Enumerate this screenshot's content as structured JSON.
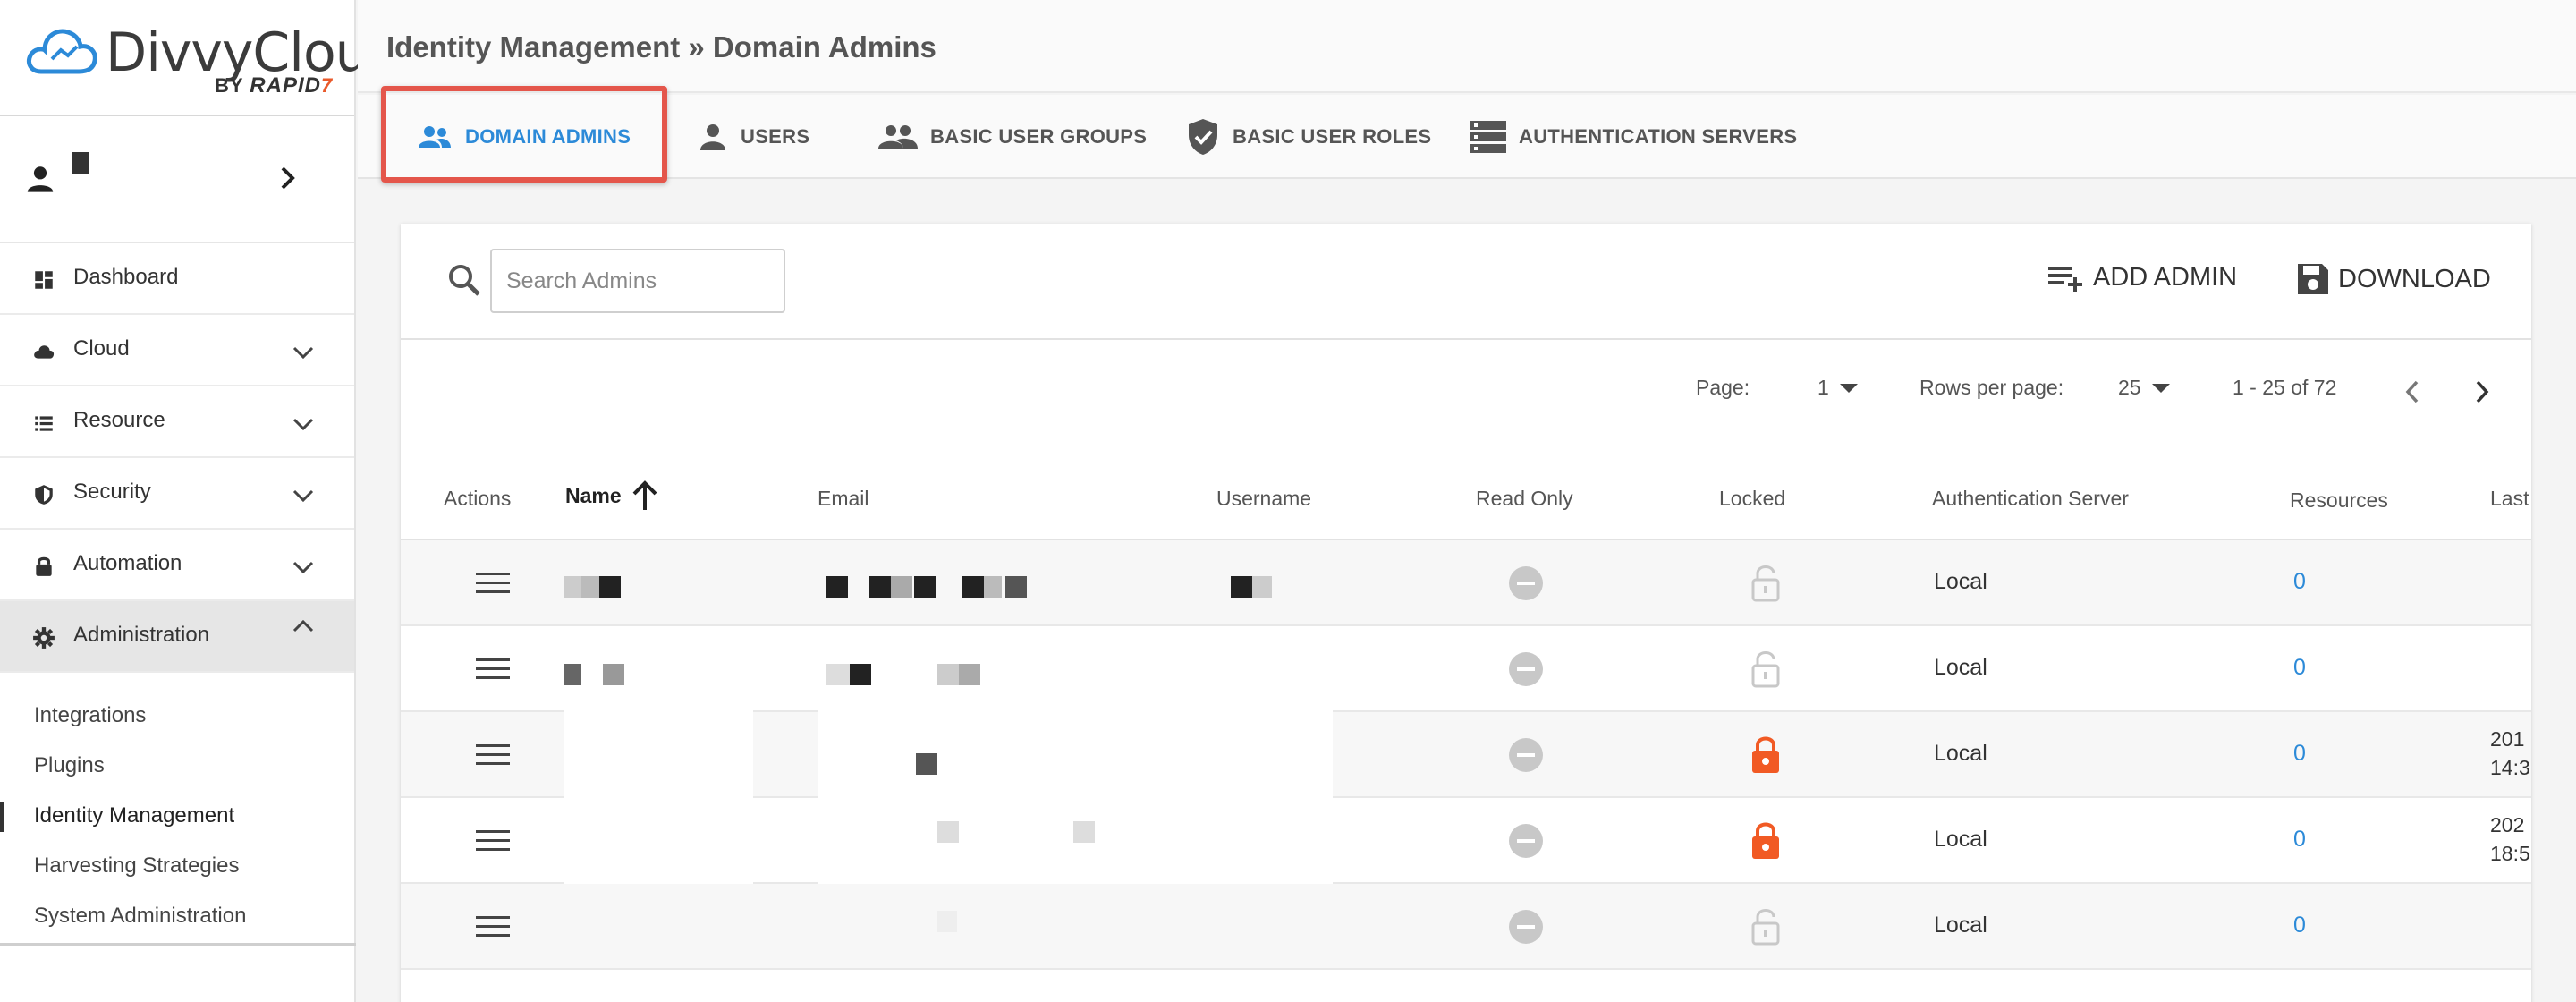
{
  "brand": {
    "name": "DivvyCloud",
    "by": "BY",
    "maker": "RAPID"
  },
  "sidebar": {
    "nav": [
      {
        "label": "Dashboard",
        "icon": "dashboard-icon"
      },
      {
        "label": "Cloud",
        "icon": "cloud-icon"
      },
      {
        "label": "Resource",
        "icon": "list-icon"
      },
      {
        "label": "Security",
        "icon": "shield-icon"
      },
      {
        "label": "Automation",
        "icon": "lock-icon"
      },
      {
        "label": "Administration",
        "icon": "gear-icon"
      }
    ],
    "sub_items": [
      "Integrations",
      "Plugins",
      "Identity Management",
      "Harvesting Strategies",
      "System Administration"
    ]
  },
  "header": {
    "title": "Identity Management » Domain Admins"
  },
  "tabs": [
    {
      "label": "DOMAIN ADMINS",
      "icon": "users-icon"
    },
    {
      "label": "USERS",
      "icon": "user-icon"
    },
    {
      "label": "BASIC USER GROUPS",
      "icon": "group-icon"
    },
    {
      "label": "BASIC USER ROLES",
      "icon": "shield-check-icon"
    },
    {
      "label": "AUTHENTICATION SERVERS",
      "icon": "server-icon"
    }
  ],
  "toolbar": {
    "search_placeholder": "Search Admins",
    "add_label": "ADD ADMIN",
    "download_label": "DOWNLOAD"
  },
  "pager": {
    "page_label": "Page:",
    "page_value": "1",
    "rows_label": "Rows per page:",
    "rows_value": "25",
    "range": "1 - 25 of 72"
  },
  "columns": [
    "Actions",
    "Name",
    "Email",
    "Username",
    "Read Only",
    "Locked",
    "Authentication Server",
    "Resources",
    "Last"
  ],
  "rows": [
    {
      "locked": false,
      "auth": "Local",
      "resources": "0",
      "last": ""
    },
    {
      "locked": false,
      "auth": "Local",
      "resources": "0",
      "last": ""
    },
    {
      "locked": true,
      "auth": "Local",
      "resources": "0",
      "last": "201\n14:3"
    },
    {
      "locked": true,
      "auth": "Local",
      "resources": "0",
      "last": "202\n18:5"
    },
    {
      "locked": false,
      "auth": "Local",
      "resources": "0",
      "last": ""
    }
  ],
  "colors": {
    "accent": "#2c8ad8",
    "locked": "#f15a24",
    "highlight": "#e4564b"
  }
}
